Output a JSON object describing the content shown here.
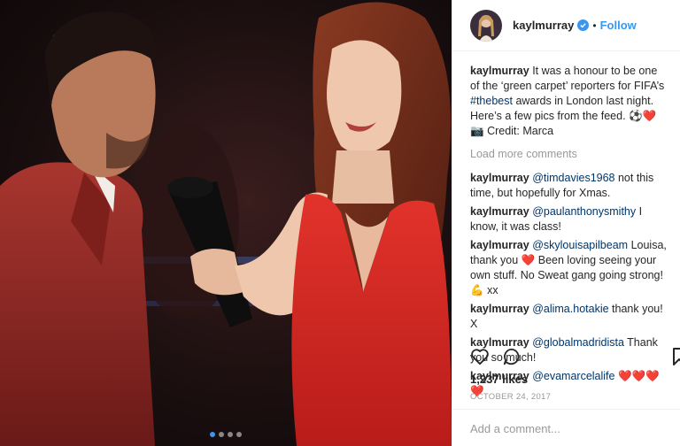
{
  "header": {
    "username": "kaylmurray",
    "separator": "•",
    "follow_label": "Follow"
  },
  "caption": {
    "username": "kaylmurray",
    "text_1": "It was a honour to be one of the ‘green carpet’ reporters for FIFA’s",
    "hashtag": "#thebest",
    "text_2": "awards in London last night. Here’s a few pics from the feed.",
    "credit": "Credit: Marca"
  },
  "load_more": "Load more comments",
  "comments": [
    {
      "user": "kaylmurray",
      "mention": "@timdavies1968",
      "text": "not this time, but hopefully for Xmas."
    },
    {
      "user": "kaylmurray",
      "mention": "@paulanthonysmithy",
      "text": "I know, it was class!"
    },
    {
      "user": "kaylmurray",
      "mention": "@skylouisapilbeam",
      "text_1": "Louisa, thank you",
      "text_2": "Been loving seeing your own stuff. No Sweat gang going strong!",
      "text_3": "xx"
    },
    {
      "user": "kaylmurray",
      "mention": "@alima.hotakie",
      "text": "thank you! X"
    },
    {
      "user": "kaylmurray",
      "mention": "@globalmadridista",
      "text": "Thank you so much!"
    },
    {
      "user": "kaylmurray",
      "mention": "@evamarcelalife",
      "hearts": "❤️❤️❤️❤️"
    }
  ],
  "likes": "1,237 likes",
  "date": "OCTOBER 24, 2017",
  "add_comment_placeholder": "Add a comment...",
  "icons": [
    "verified-icon",
    "heart-icon",
    "comment-icon",
    "bookmark-icon",
    "soccer-ball-icon",
    "camera-icon",
    "flexed-biceps-icon"
  ],
  "colors": {
    "link": "#3897f0",
    "mention": "#003569",
    "heart": "#ed4956",
    "muted": "#999999"
  },
  "carousel": {
    "count": 4,
    "active_index": 0
  }
}
